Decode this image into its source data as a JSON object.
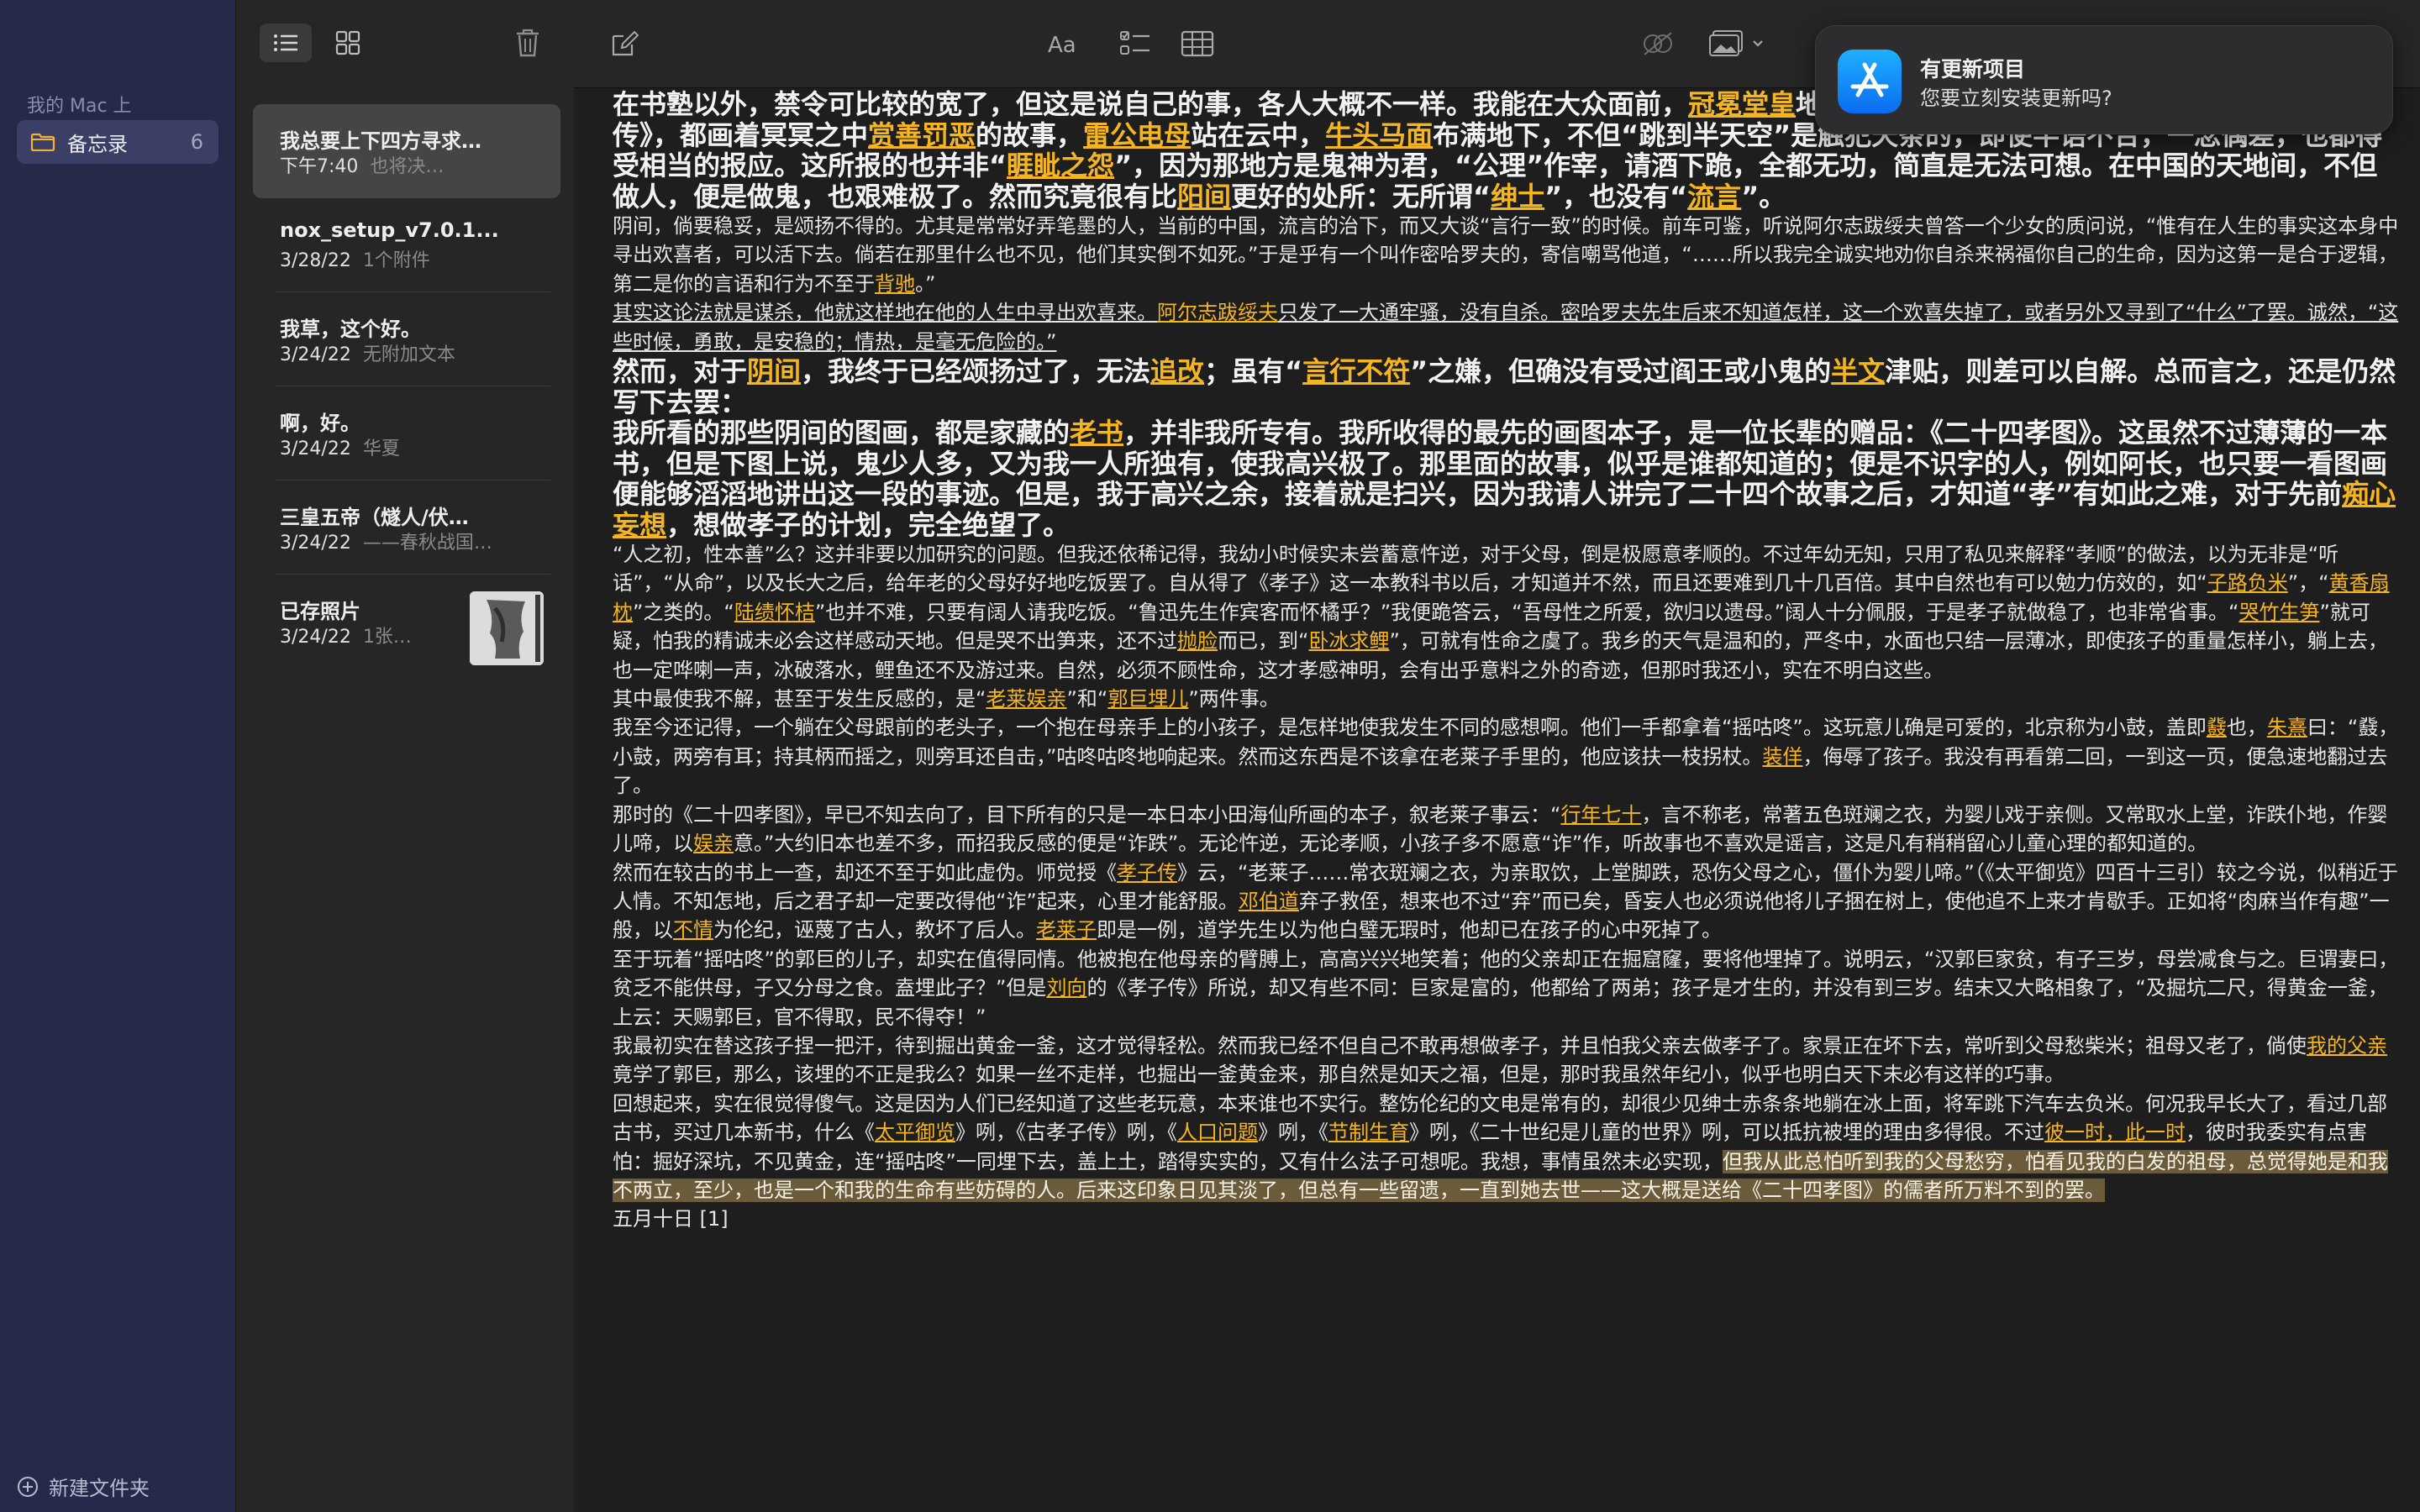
{
  "sidebar": {
    "section_label": "我的 Mac 上",
    "folder": {
      "label": "备忘录",
      "count": "6",
      "icon": "folder-icon"
    },
    "new_folder_label": "新建文件夹"
  },
  "notes_list": [
    {
      "title": "我总要上下四方寻求…",
      "date": "下午7:40",
      "preview": "也将决…",
      "selected": true
    },
    {
      "title": "nox_setup_v7.0.1....",
      "date": "3/28/22",
      "preview": "1个附件"
    },
    {
      "title": "我草，这个好。",
      "date": "3/24/22",
      "preview": "无附加文本"
    },
    {
      "title": "啊，好。",
      "date": "3/24/22",
      "preview": "华夏"
    },
    {
      "title": "三皇五帝（燧人/伏…",
      "date": "3/24/22",
      "preview": "——春秋战国…"
    },
    {
      "title": "已存照片",
      "date": "3/24/22",
      "preview": "1张…",
      "has_thumbnail": true
    }
  ],
  "notification": {
    "title": "有更新项目",
    "body": "您要立刻安装更新吗?",
    "icon": "app-store-icon"
  },
  "editor": {
    "blocks": [
      {
        "style": "big",
        "runs": [
          {
            "t": "在书塾以外，禁令可比较的宽了，但这是说自己的事，各人大概不一样。我能在大众面前，"
          },
          {
            "t": "冠冕堂皇",
            "link": true
          },
          {
            "t": "地阅看的，是《文昌帝君阴骘文图说》和《玉历钞传》，都画着冥冥之中"
          },
          {
            "t": "赏善罚恶",
            "link": true
          },
          {
            "t": "的故事，"
          },
          {
            "t": "雷公电母",
            "link": true
          },
          {
            "t": "站在云中，"
          },
          {
            "t": "牛头马面",
            "link": true
          },
          {
            "t": "布满地下，不但“跳到半天空”是触犯天条的，即使半语不合，一念偶差，也都得受相当的报应。这所报的也并非“"
          },
          {
            "t": "睚眦之怨",
            "link": true
          },
          {
            "t": "”，因为那地方是鬼神为君，“公理”作宰，请酒下跪，全都无功，简直是无法可想。在中国的天地间，不但做人，便是做鬼，也艰难极了。然而究竟很有比"
          },
          {
            "t": "阳间",
            "link": true
          },
          {
            "t": "更好的处所：无所谓“"
          },
          {
            "t": "绅士",
            "link": true
          },
          {
            "t": "”，也没有“"
          },
          {
            "t": "流言",
            "link": true
          },
          {
            "t": "”。"
          }
        ]
      },
      {
        "style": "small",
        "runs": [
          {
            "t": "阴间，倘要稳妥，是颂扬不得的。尤其是常常好弄笔墨的人，当前的中国，流言的治下，而又大谈“言行一致”的时候。前车可鉴，听说阿尔志跋绥夫曾答一个少女的质问说，“惟有在人生的事实这本身中寻出欢喜者，可以活下去。倘若在那里什么也不见，他们其实倒不如死。”于是乎有一个叫作密哈罗夫的，寄信嘲骂他道，“……所以我完全诚实地劝你自杀来祸福你自己的生命，因为这第一是合于逻辑，第二是你的言语和行为不至于"
          },
          {
            "t": "背驰",
            "link": true
          },
          {
            "t": "。”"
          }
        ]
      },
      {
        "style": "small",
        "runs": [
          {
            "t": "其实这论法就是谋杀，他就这样地在他的人生中寻出欢喜来。",
            "ul": true
          },
          {
            "t": "阿尔志跋绥夫",
            "link": true
          },
          {
            "t": "只发了一大通牢骚，没有自杀。密哈罗夫先生后来不知道怎样，这一个欢喜失掉了，或者另外又寻到了“什么”了罢。诚然，“这些时候，勇敢，是安稳的；情热，是毫无危险的。”",
            "ul": true
          }
        ]
      },
      {
        "style": "big",
        "runs": [
          {
            "t": "然而，对于"
          },
          {
            "t": "阴间",
            "link": true
          },
          {
            "t": "，我终于已经颂扬过了，无法"
          },
          {
            "t": "追改",
            "link": true
          },
          {
            "t": "；虽有“"
          },
          {
            "t": "言行不符",
            "link": true
          },
          {
            "t": "”之嫌，但确没有受过阎王或小鬼的"
          },
          {
            "t": "半文",
            "link": true
          },
          {
            "t": "津贴，则差可以自解。总而言之，还是仍然写下去罢："
          }
        ]
      },
      {
        "style": "big",
        "runs": [
          {
            "t": "我所看的那些阴间的图画，都是家藏的"
          },
          {
            "t": "老书",
            "link": true
          },
          {
            "t": "，并非我所专有。我所收得的最先的画图本子，是一位长辈的赠品：《二十四孝图》。这虽然不过薄薄的一本书，但是下图上说，鬼少人多，又为我一人所独有，使我高兴极了。那里面的故事，似乎是谁都知道的；便是不识字的人，例如阿长，也只要一看图画便能够滔滔地讲出这一段的事迹。但是，我于高兴之余，接着就是扫兴，因为我请人讲完了二十四个故事之后，才知道“孝”有如此之难，对于先前"
          },
          {
            "t": "痴心妄想",
            "link": true
          },
          {
            "t": "，想做孝子的计划，完全绝望了。"
          }
        ]
      },
      {
        "style": "small",
        "runs": [
          {
            "t": "“人之初，性本善”么？这并非要以加研究的问题。但我还依稀记得，我幼小时候实未尝蓄意忤逆，对于父母，倒是极愿意孝顺的。不过年幼无知，只用了私见来解释“孝顺”的做法，以为无非是“听话”，“从命”，以及长大之后，给年老的父母好好地吃饭罢了。自从得了《孝子》这一本教科书以后，才知道并不然，而且还要难到几十几百倍。其中自然也有可以勉力仿效的，如“"
          },
          {
            "t": "子路负米",
            "link": true
          },
          {
            "t": "”，“"
          },
          {
            "t": "黄香扇枕",
            "link": true
          },
          {
            "t": "”之类的。“"
          },
          {
            "t": "陆绩怀桔",
            "link": true
          },
          {
            "t": "”也并不难，只要有阔人请我吃饭。“鲁迅先生作宾客而怀橘乎？”我便跪答云，“吾母性之所爱，欲归以遗母。”阔人十分佩服，于是孝子就做稳了，也非常省事。“"
          },
          {
            "t": "哭竹生笋",
            "link": true
          },
          {
            "t": "”就可疑，怕我的精诚未必会这样感动天地。但是哭不出笋来，还不过"
          },
          {
            "t": "抛脸",
            "link": true
          },
          {
            "t": "而已，到“"
          },
          {
            "t": "卧冰求鲤",
            "link": true
          },
          {
            "t": "”，可就有性命之虞了。我乡的天气是温和的，严冬中，水面也只结一层薄冰，即使孩子的重量怎样小，躺上去，也一定哗喇一声，冰破落水，鲤鱼还不及游过来。自然，必须不顾性命，这才孝感神明，会有出乎意料之外的奇迹，但那时我还小，实在不明白这些。"
          }
        ]
      },
      {
        "style": "small",
        "runs": [
          {
            "t": "其中最使我不解，甚至于发生反感的，是“"
          },
          {
            "t": "老莱娱亲",
            "link": true
          },
          {
            "t": "”和“"
          },
          {
            "t": "郭巨埋儿",
            "link": true
          },
          {
            "t": "”两件事。"
          }
        ]
      },
      {
        "style": "small",
        "runs": [
          {
            "t": "我至今还记得，一个躺在父母跟前的老头子，一个抱在母亲手上的小孩子，是怎样地使我发生不同的感想啊。他们一手都拿着“摇咕咚”。这玩意儿确是可爱的，北京称为小鼓，盖即"
          },
          {
            "t": "鼗",
            "link": true
          },
          {
            "t": "也，"
          },
          {
            "t": "朱熹",
            "link": true
          },
          {
            "t": "曰：“鼗，小鼓，两旁有耳；持其柄而摇之，则旁耳还自击，”咕咚咕咚地响起来。然而这东西是不该拿在老莱子手里的，他应该扶一枝拐杖。"
          },
          {
            "t": "装佯",
            "link": true
          },
          {
            "t": "，侮辱了孩子。我没有再看第二回，一到这一页，便急速地翻过去了。"
          }
        ]
      },
      {
        "style": "small",
        "runs": [
          {
            "t": "那时的《二十四孝图》，早已不知去向了，目下所有的只是一本日本小田海仙所画的本子，叙老莱子事云：“"
          },
          {
            "t": "行年七十",
            "link": true
          },
          {
            "t": "，言不称老，常著五色斑斓之衣，为婴儿戏于亲侧。又常取水上堂，诈跌仆地，作婴儿啼，以"
          },
          {
            "t": "娱亲",
            "link": true
          },
          {
            "t": "意。”大约旧本也差不多，而招我反感的便是“诈跌”。无论忤逆，无论孝顺，小孩子多不愿意“诈”作，听故事也不喜欢是谣言，这是凡有稍稍留心儿童心理的都知道的。"
          }
        ]
      },
      {
        "style": "small",
        "runs": [
          {
            "t": "然而在较古的书上一查，却还不至于如此虚伪。师觉授《"
          },
          {
            "t": "孝子传",
            "link": true
          },
          {
            "t": "》云，“老莱子……常衣斑斓之衣，为亲取饮，上堂脚跌，恐伤父母之心，僵仆为婴儿啼。”（《太平御览》四百十三引）较之今说，似稍近于人情。不知怎地，后之君子却一定要改得他“诈”起来，心里才能舒服。"
          },
          {
            "t": "邓伯道",
            "link": true
          },
          {
            "t": "弃子救侄，想来也不过“弃”而已矣，昏妄人也必须说他将儿子捆在树上，使他追不上来才肯歇手。正如将“肉麻当作有趣”一般，以"
          },
          {
            "t": "不情",
            "link": true
          },
          {
            "t": "为伦纪，诬蔑了古人，教坏了后人。"
          },
          {
            "t": "老莱子",
            "link": true
          },
          {
            "t": "即是一例，道学先生以为他白璧无瑕时，他却已在孩子的心中死掉了。"
          }
        ]
      },
      {
        "style": "small",
        "runs": [
          {
            "t": "至于玩着“摇咕咚”的郭巨的儿子，却实在值得同情。他被抱在他母亲的臂膊上，高高兴兴地笑着；他的父亲却正在掘窟窿，要将他埋掉了。说明云，“汉郭巨家贫，有子三岁，母尝减食与之。巨谓妻曰，贫乏不能供母，子又分母之食。盍埋此子？”但是"
          },
          {
            "t": "刘向",
            "link": true
          },
          {
            "t": "的《孝子传》所说，却又有些不同：巨家是富的，他都给了两弟；孩子是才生的，并没有到三岁。结末又大略相象了，“及掘坑二尺，得黄金一釜，上云：天赐郭巨，官不得取，民不得夺！”"
          }
        ]
      },
      {
        "style": "small",
        "runs": [
          {
            "t": "我最初实在替这孩子捏一把汗，待到掘出黄金一釜，这才觉得轻松。然而我已经不但自己不敢再想做孝子，并且怕我父亲去做孝子了。家景正在坏下去，常听到父母愁柴米；祖母又老了，倘使"
          },
          {
            "t": "我的父亲",
            "link": true
          },
          {
            "t": "竟学了郭巨，那么，该埋的不正是我么？如果一丝不走样，也掘出一釜黄金来，那自然是如天之福，但是，那时我虽然年纪小，似乎也明白天下未必有这样的巧事。"
          }
        ]
      },
      {
        "style": "small",
        "runs": [
          {
            "t": "回想起来，实在很觉得傻气。这是因为人们已经知道了这些老玩意，本来谁也不实行。整饬伦纪的文电是常有的，却很少见绅士赤条条地躺在冰上面，将军跳下汽车去负米。何况我早长大了，看过几部古书，买过几本新书，什么《"
          },
          {
            "t": "太平御览",
            "link": true
          },
          {
            "t": "》咧，《古孝子传》咧，《"
          },
          {
            "t": "人口问题",
            "link": true
          },
          {
            "t": "》咧，《"
          },
          {
            "t": "节制生育",
            "link": true
          },
          {
            "t": "》咧，《二十世纪是儿童的世界》咧，可以抵抗被埋的理由多得很。不过"
          },
          {
            "t": "彼一时，此一时",
            "link": true
          },
          {
            "t": "，彼时我委实有点害怕：掘好深坑，不见黄金，连“摇咕咚”一同埋下去，盖上土，踏得实实的，又有什么法子可想呢。我想，事情虽然未必实现，"
          },
          {
            "t": "但我从此总怕听到我的父母愁穷，怕看见我的白发的祖母，总觉得她是和我不两立，至少，也是一个和我的生命有些妨碍的人。后来这印象日见其淡了，但总有一些留遗，一直到她去世——这大概是送给《二十四孝图》的儒者所万料不到的罢。",
            "hl": true
          }
        ]
      },
      {
        "style": "small",
        "runs": [
          {
            "t": "五月十日 [1]"
          }
        ]
      }
    ]
  }
}
